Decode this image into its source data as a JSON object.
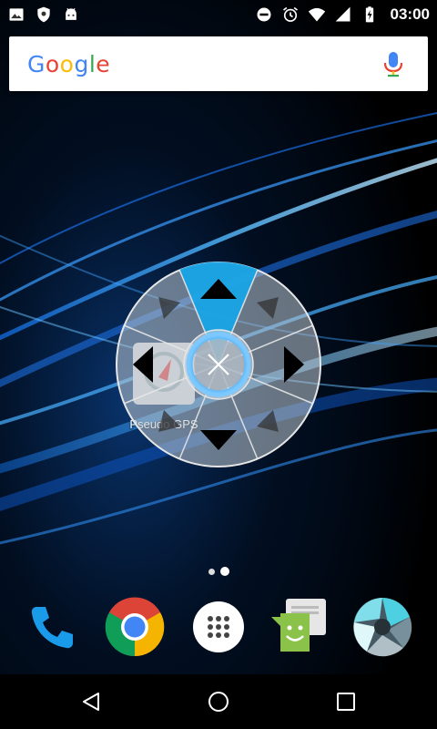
{
  "status_bar": {
    "time": "03:00",
    "left_icons": [
      "image-icon",
      "shield-icon",
      "android-icon"
    ],
    "right_icons": [
      "do-not-disturb-icon",
      "alarm-icon",
      "wifi-icon",
      "signal-icon",
      "battery-charging-icon"
    ]
  },
  "search_bar": {
    "logo_letters": [
      "G",
      "o",
      "o",
      "g",
      "l",
      "e"
    ],
    "logo_colors": [
      "#4285F4",
      "#EA4335",
      "#FBBC05",
      "#4285F4",
      "#34A853",
      "#EA4335"
    ],
    "mic_icon": "mic-icon"
  },
  "joystick": {
    "directions": [
      "up",
      "up-right",
      "right",
      "down-right",
      "down",
      "down-left",
      "left",
      "up-left"
    ],
    "active_direction": "up",
    "active_color": "#19A4E6",
    "center_icon": "close-icon"
  },
  "home_app": {
    "label": "Pseudo GPS",
    "icon": "map-pin-icon"
  },
  "page_indicator": {
    "pages": 2,
    "current": 2
  },
  "dock": {
    "apps": [
      {
        "icon": "phone-icon",
        "color": "#1A9BEA"
      },
      {
        "icon": "chrome-icon",
        "color": "#4285F4"
      },
      {
        "icon": "app-drawer-icon",
        "color": "#FFFFFF"
      },
      {
        "icon": "messenger-icon",
        "color": "#8BC34A"
      },
      {
        "icon": "camera-icon",
        "color": "#4DD0E1"
      }
    ]
  },
  "nav_bar": {
    "buttons": [
      "back-icon",
      "home-icon",
      "recents-icon"
    ]
  }
}
